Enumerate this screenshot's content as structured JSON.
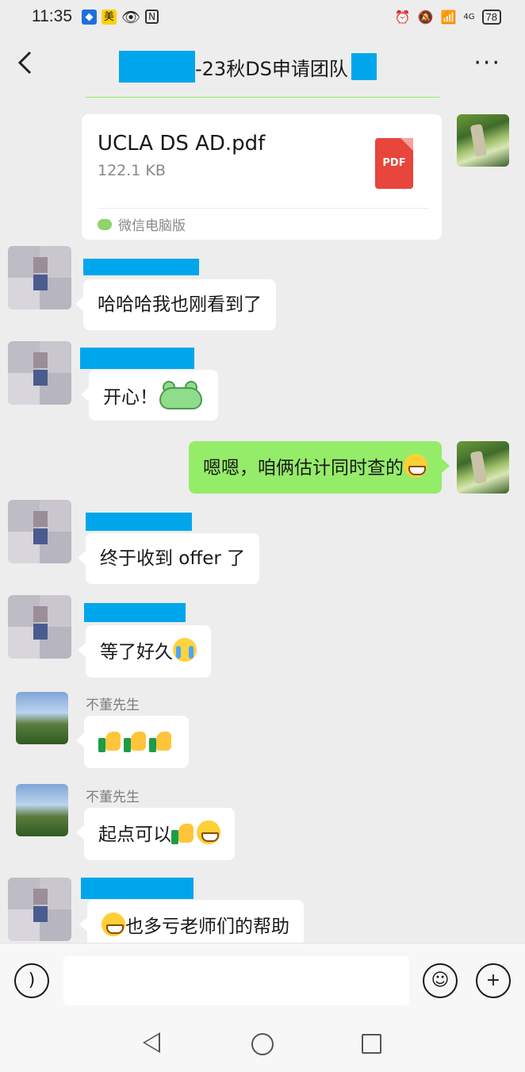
{
  "status_bar": {
    "time": "11:35",
    "app_icons": [
      "map-icon",
      "meituan-icon",
      "eye-icon",
      "nfc-icon"
    ],
    "meituan_label": "美",
    "right_icons": [
      "alarm-icon",
      "mute-icon",
      "wifi-icon",
      "signal-icon"
    ],
    "network": "4G",
    "battery": "78"
  },
  "header": {
    "title": "-23秋DS申请团队",
    "back_icon": "chevron-left-icon",
    "more_label": "···"
  },
  "file_message": {
    "name": "UCLA DS AD.pdf",
    "size": "122.1 KB",
    "badge": "PDF",
    "source": "微信电脑版"
  },
  "messages": [
    {
      "sender": "",
      "text": "哈哈哈我也刚看到了"
    },
    {
      "sender": "",
      "text": "开心！"
    },
    {
      "sender": "me",
      "text": "嗯嗯，咱俩估计同时查的"
    },
    {
      "sender": "",
      "text": "终于收到 offer 了"
    },
    {
      "sender": "",
      "text": "等了好久"
    },
    {
      "sender": "不董先生",
      "text": ""
    },
    {
      "sender": "不董先生",
      "text": "起点可以"
    },
    {
      "sender": "",
      "text": "也多亏老师们的帮助"
    }
  ],
  "input_bar": {
    "voice_icon": "voice-icon",
    "emoji_icon": "smiley-icon",
    "add_icon": "plus-icon",
    "placeholder": ""
  },
  "colors": {
    "background": "#ededed",
    "my_bubble": "#95ec69",
    "their_bubble": "#ffffff",
    "redaction": "#00a6ec",
    "pdf_red": "#e8453c"
  }
}
